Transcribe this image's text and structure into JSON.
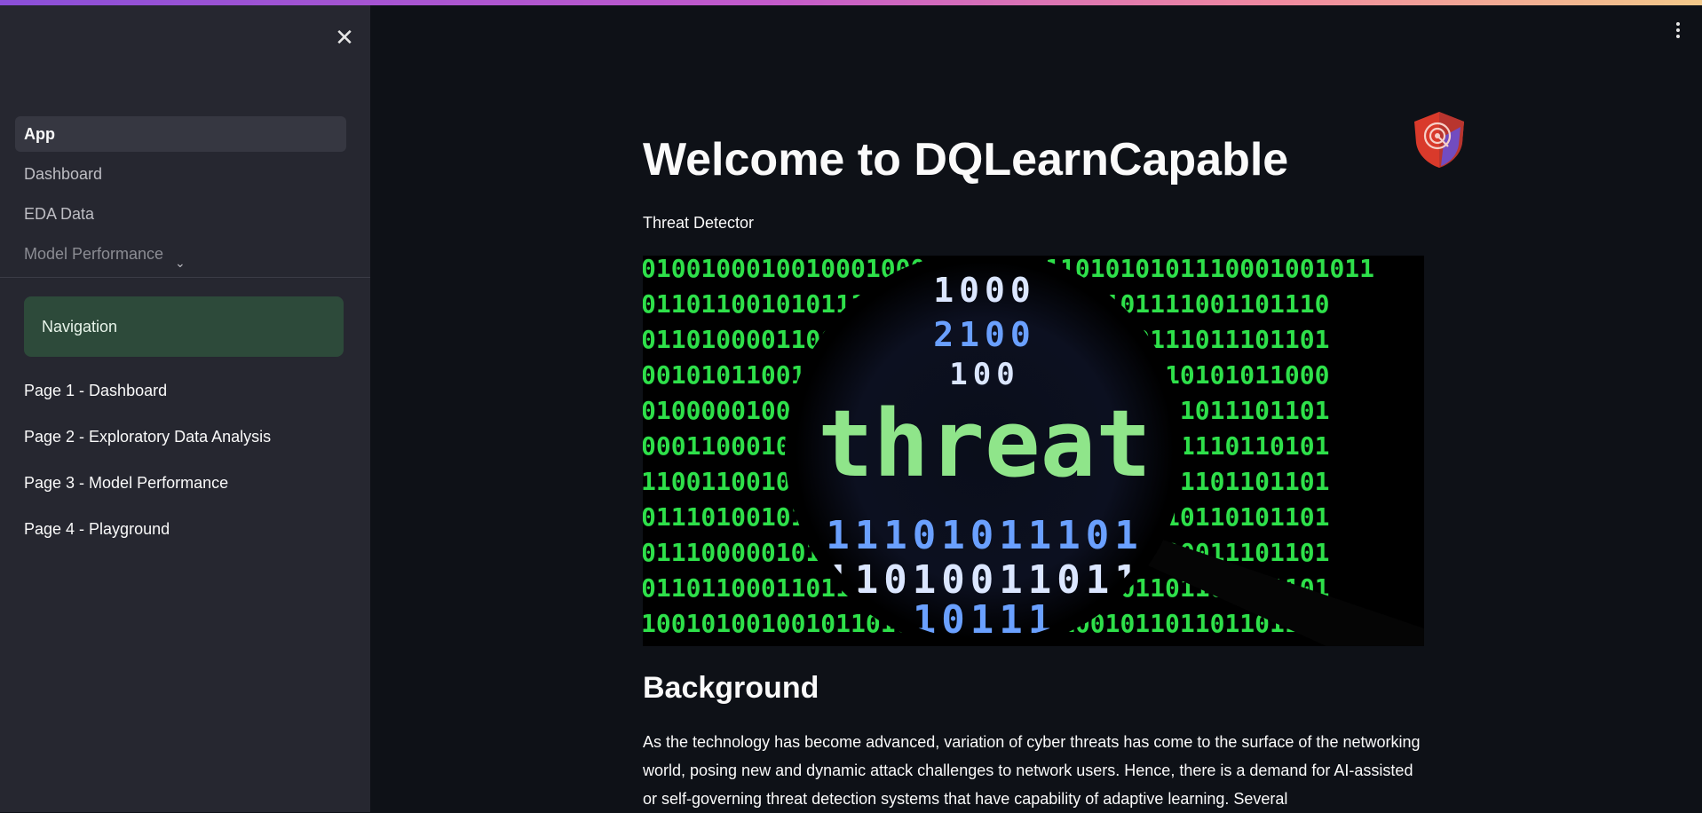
{
  "sidebar": {
    "pages": [
      {
        "label": "App",
        "active": true
      },
      {
        "label": "Dashboard"
      },
      {
        "label": "EDA Data"
      },
      {
        "label": "Model Performance"
      }
    ],
    "navigation_heading": "Navigation",
    "page_links": [
      "Page 1 - Dashboard",
      "Page 2 - Exploratory Data Analysis",
      "Page 3 - Model Performance",
      "Page 4 - Playground"
    ]
  },
  "main": {
    "title": "Welcome to DQLearnCapable",
    "subtitle": "Threat Detector",
    "hero_image": {
      "caption_word": "threat",
      "binary_rows": [
        "0100100010010001000010100011101010101110001001011",
        "0110110010101111100100110000101101111001101110",
        "0110100001100101011000101001000000111011101101",
        "0010101100101010101011100001000010010101011000",
        "0100000100101001010010100001000000111011101101",
        "0001100010100111000110100110111000101110110101",
        "1100110010011101100010000111010001101101101101",
        "0111010010101101001001011100111010010110101101",
        "0111000001011011100010011100011011100011101101",
        "0110110001101101100011011010110101101101101101",
        "1001010010010110100011000110100101101101101101"
      ],
      "lens_rows": [
        "1000",
        "2100",
        "100",
        "11101011101",
        "11010011011",
        "10111"
      ]
    },
    "section_heading": "Background",
    "paragraph": "As the technology has become advanced, variation of cyber threats has come to the surface of the networking world, posing new and dynamic attack challenges to network users. Hence, there is a demand for AI-assisted or self-governing threat detection systems that have capability of adaptive learning. Several"
  },
  "colors": {
    "background": "#0e1117",
    "sidebar": "#262730",
    "nav_box": "#2d4a3a",
    "binary_green": "#2ee04a",
    "threat_text": "#8fe58a"
  }
}
